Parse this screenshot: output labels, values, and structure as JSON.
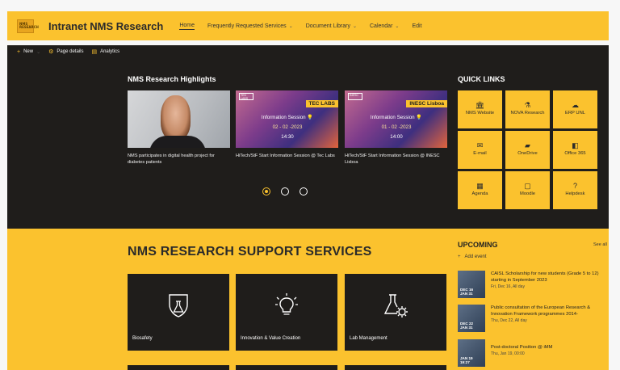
{
  "site": {
    "logo_text": "NMS RESEARCH",
    "title": "Intranet NMS Research"
  },
  "nav": [
    {
      "label": "Home",
      "active": true,
      "chevron": false
    },
    {
      "label": "Frequently Requested Services",
      "chevron": true
    },
    {
      "label": "Document Library",
      "chevron": true
    },
    {
      "label": "Calendar",
      "chevron": true
    },
    {
      "label": "Edit",
      "chevron": false
    }
  ],
  "commands": {
    "new": "New",
    "page_details": "Page details",
    "analytics": "Analytics"
  },
  "highlights": {
    "title": "NMS Research Highlights",
    "cards": [
      {
        "caption": "NMS participates in digital health project for diabetes patients"
      },
      {
        "badge": "TEC LABS",
        "logo": "TEC LABS",
        "session": "Information Session",
        "date": "02 - 02 -2023",
        "time": "14:30",
        "caption": "HiTech/StF Start Information Session @ Tec Labs"
      },
      {
        "badge": "INESC Lisboa",
        "logo": "INESC",
        "session": "Information Session",
        "date": "01 - 02 -2023",
        "time": "14:00",
        "caption": "HiTech/StF Start Information Session @ INESC Lisboa"
      }
    ]
  },
  "quick_links": {
    "title": "QUICK LINKS",
    "items": [
      {
        "label": "NMS Website",
        "icon": "building-icon"
      },
      {
        "label": "NOVA Research",
        "icon": "flask-icon"
      },
      {
        "label": "ERP UNL",
        "icon": "cloud-icon"
      },
      {
        "label": "E-mail",
        "icon": "outlook-icon"
      },
      {
        "label": "OneDrive",
        "icon": "onedrive-icon"
      },
      {
        "label": "Office 365",
        "icon": "office-icon"
      },
      {
        "label": "Agenda",
        "icon": "calendar-icon"
      },
      {
        "label": "Moodle",
        "icon": "moodle-icon"
      },
      {
        "label": "Helpdesk",
        "icon": "question-icon"
      }
    ]
  },
  "services": {
    "title": "NMS RESEARCH SUPPORT SERVICES",
    "items": [
      {
        "label": "Biosafety",
        "icon": "biosafety-shield-icon"
      },
      {
        "label": "Innovation & Value Creation",
        "icon": "lightbulb-icon"
      },
      {
        "label": "Lab Management",
        "icon": "flask-gear-icon"
      }
    ]
  },
  "upcoming": {
    "title": "UPCOMING",
    "see_all": "See all",
    "add_event": "Add event",
    "events": [
      {
        "title": "CAISL Scholarship for new students (Grade 5 to 12) starting in September 2023",
        "date": "Fri, Dec 16, All day",
        "thumb_date": "DEC 16\nJAN 31"
      },
      {
        "title": "Public consultation of the European Research & Innovation Framework programmes 2014-",
        "date": "Thu, Dec 22, All day",
        "thumb_date": "DEC 22\nJAN 31"
      },
      {
        "title": "Post-doctoral Position @ iMM",
        "date": "Thu, Jan 19, 00:00",
        "thumb_date": "JAN 19\n19:27"
      }
    ]
  },
  "colors": {
    "brand_yellow": "#fbc22e",
    "dark_bg": "#1f1d1b"
  }
}
